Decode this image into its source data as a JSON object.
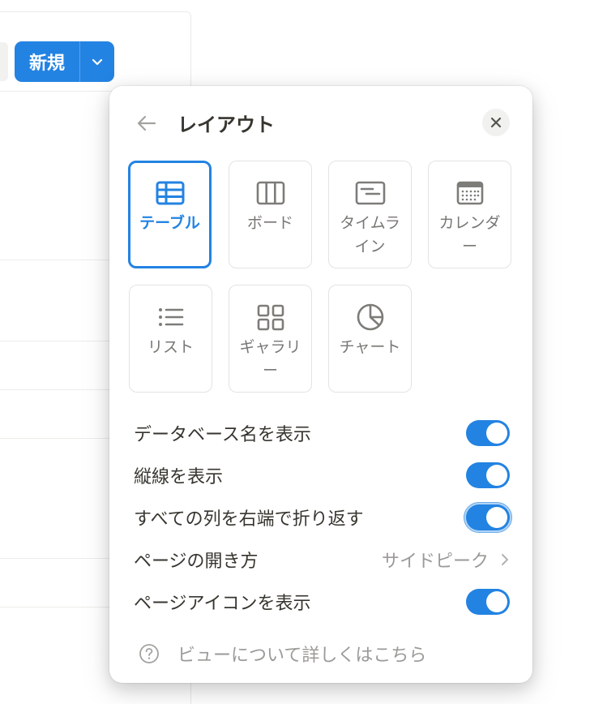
{
  "background": {
    "new_button": {
      "label": "新規",
      "dropdown_icon": "chevron-down-icon"
    }
  },
  "popover": {
    "title": "レイアウト",
    "back_icon": "arrow-left-icon",
    "close_icon": "close-icon",
    "layouts": [
      {
        "label": "テーブル",
        "icon": "table-icon",
        "selected": true
      },
      {
        "label": "ボード",
        "icon": "board-icon",
        "selected": false
      },
      {
        "label": "タイムライン",
        "icon": "timeline-icon",
        "selected": false
      },
      {
        "label": "カレンダー",
        "icon": "calendar-icon",
        "selected": false
      },
      {
        "label": "リスト",
        "icon": "list-icon",
        "selected": false
      },
      {
        "label": "ギャラリー",
        "icon": "gallery-icon",
        "selected": false
      },
      {
        "label": "チャート",
        "icon": "chart-icon",
        "selected": false
      }
    ],
    "settings": [
      {
        "label": "データベース名を表示",
        "type": "toggle",
        "on": true
      },
      {
        "label": "縦線を表示",
        "type": "toggle",
        "on": true
      },
      {
        "label": "すべての列を右端で折り返す",
        "type": "toggle",
        "on": true,
        "focused": true
      },
      {
        "label": "ページの開き方",
        "type": "select",
        "value": "サイドピーク"
      },
      {
        "label": "ページアイコンを表示",
        "type": "toggle",
        "on": true
      }
    ],
    "help": {
      "label": "ビューについて詳しくはこちら",
      "icon": "help-circle-icon"
    }
  },
  "colors": {
    "accent": "#2383e2",
    "text": "#37352f",
    "muted": "#9b9a97"
  }
}
